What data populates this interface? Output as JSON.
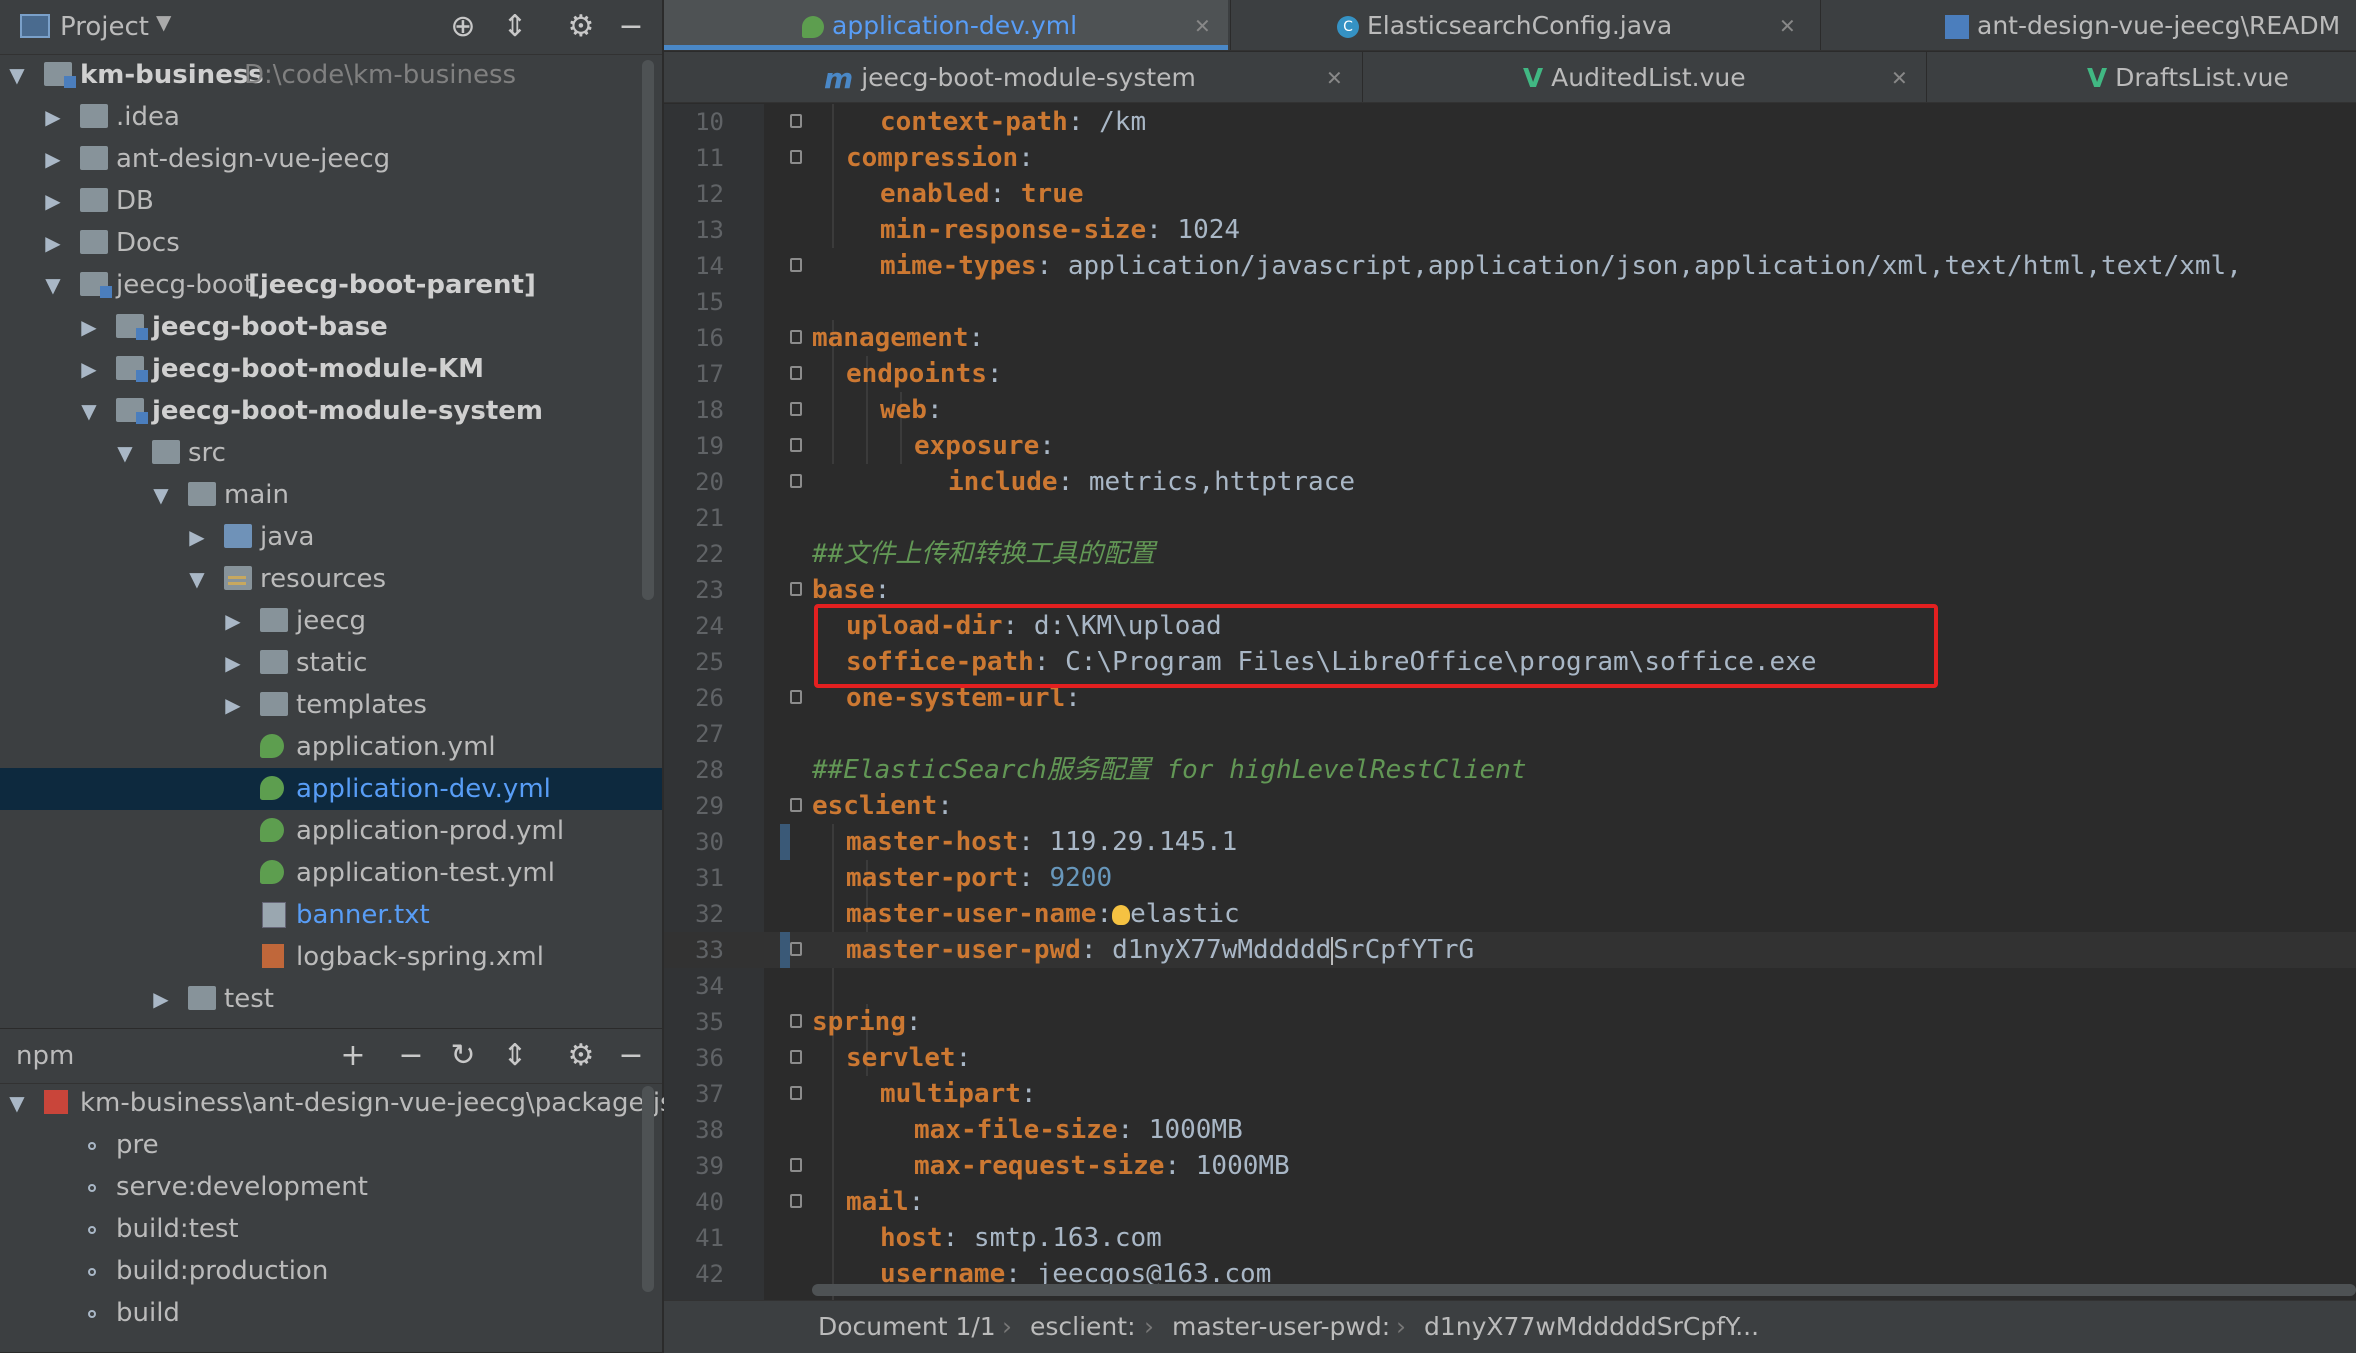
{
  "project_panel": {
    "title": "Project",
    "tree": [
      {
        "label": "km-business",
        "extra": "D:\\code\\km-business"
      },
      {
        "label": ".idea"
      },
      {
        "label": "ant-design-vue-jeecg"
      },
      {
        "label": "DB"
      },
      {
        "label": "Docs"
      },
      {
        "label": "jeecg-boot",
        "extra": "[jeecg-boot-parent]"
      },
      {
        "label": "jeecg-boot-base"
      },
      {
        "label": "jeecg-boot-module-KM"
      },
      {
        "label": "jeecg-boot-module-system"
      },
      {
        "label": "src"
      },
      {
        "label": "main"
      },
      {
        "label": "java"
      },
      {
        "label": "resources"
      },
      {
        "label": "jeecg"
      },
      {
        "label": "static"
      },
      {
        "label": "templates"
      },
      {
        "label": "application.yml"
      },
      {
        "label": "application-dev.yml"
      },
      {
        "label": "application-prod.yml"
      },
      {
        "label": "application-test.yml"
      },
      {
        "label": "banner.txt"
      },
      {
        "label": "logback-spring.xml"
      },
      {
        "label": "test"
      }
    ]
  },
  "npm_panel": {
    "title": "npm",
    "root": "km-business\\ant-design-vue-jeecg\\package.json",
    "scripts": [
      "pre",
      "serve:development",
      "build:test",
      "build:production",
      "build"
    ]
  },
  "tabs_row1": [
    {
      "label": "application-dev.yml"
    },
    {
      "label": "ElasticsearchConfig.java"
    },
    {
      "label": "ant-design-vue-jeecg\\READM"
    }
  ],
  "tabs_row2": [
    {
      "label": "jeecg-boot-module-system"
    },
    {
      "label": "AuditedList.vue"
    },
    {
      "label": "DraftsList.vue"
    }
  ],
  "code": {
    "l10": {
      "n": "10",
      "k": "context-path",
      "v": " /km"
    },
    "l11": {
      "n": "11",
      "k": "compression",
      "v": ""
    },
    "l12": {
      "n": "12",
      "k": "enabled",
      "v": " true"
    },
    "l13": {
      "n": "13",
      "k": "min-response-size",
      "v": " 1024"
    },
    "l14": {
      "n": "14",
      "k": "mime-types",
      "v": " application/javascript,application/json,application/xml,text/html,text/xml,"
    },
    "l15": {
      "n": "15"
    },
    "l16": {
      "n": "16",
      "k": "management",
      "v": ""
    },
    "l17": {
      "n": "17",
      "k": "endpoints",
      "v": ""
    },
    "l18": {
      "n": "18",
      "k": "web",
      "v": ""
    },
    "l19": {
      "n": "19",
      "k": "exposure",
      "v": ""
    },
    "l20": {
      "n": "20",
      "k": "include",
      "v": " metrics,httptrace"
    },
    "l21": {
      "n": "21"
    },
    "l22": {
      "n": "22",
      "c": "##文件上传和转换工具的配置"
    },
    "l23": {
      "n": "23",
      "k": "base",
      "v": ""
    },
    "l24": {
      "n": "24",
      "k": "upload-dir",
      "v": " d:\\KM\\upload"
    },
    "l25": {
      "n": "25",
      "k": "soffice-path",
      "v": " C:\\Program Files\\LibreOffice\\program\\soffice.exe"
    },
    "l26": {
      "n": "26",
      "k": "one-system-url",
      "v": ""
    },
    "l27": {
      "n": "27"
    },
    "l28": {
      "n": "28",
      "c": "##ElasticSearch服务配置 for highLevelRestClient"
    },
    "l29": {
      "n": "29",
      "k": "esclient",
      "v": ""
    },
    "l30": {
      "n": "30",
      "k": "master-host",
      "v": " 119.29.145.1"
    },
    "l31": {
      "n": "31",
      "k": "master-port",
      "v": " 9200"
    },
    "l32": {
      "n": "32",
      "k": "master-user-name",
      "v": "elastic"
    },
    "l33": {
      "n": "33",
      "k": "master-user-pwd",
      "v1": " d1nyX77wMddddd",
      "v2": "SrCpfYTrG"
    },
    "l34": {
      "n": "34"
    },
    "l35": {
      "n": "35",
      "k": "spring",
      "v": ""
    },
    "l36": {
      "n": "36",
      "k": "servlet",
      "v": ""
    },
    "l37": {
      "n": "37",
      "k": "multipart",
      "v": ""
    },
    "l38": {
      "n": "38",
      "k": "max-file-size",
      "v": " 1000MB"
    },
    "l39": {
      "n": "39",
      "k": "max-request-size",
      "v": " 1000MB"
    },
    "l40": {
      "n": "40",
      "k": "mail",
      "v": ""
    },
    "l41": {
      "n": "41",
      "k": "host",
      "v": " smtp.163.com"
    },
    "l42": {
      "n": "42",
      "k": "username",
      "v": " jeecgos@163.com"
    }
  },
  "statusbar": {
    "doc": "Document 1/1",
    "crumb1": "esclient:",
    "crumb2": "master-user-pwd:",
    "crumb3": "d1nyX77wMdddddSrCpfY..."
  },
  "colors": {
    "keyword": "#cc7832",
    "comment": "#629755",
    "number": "#6897bb",
    "highlight_box": "#e32020",
    "selection": "#0d293e"
  }
}
